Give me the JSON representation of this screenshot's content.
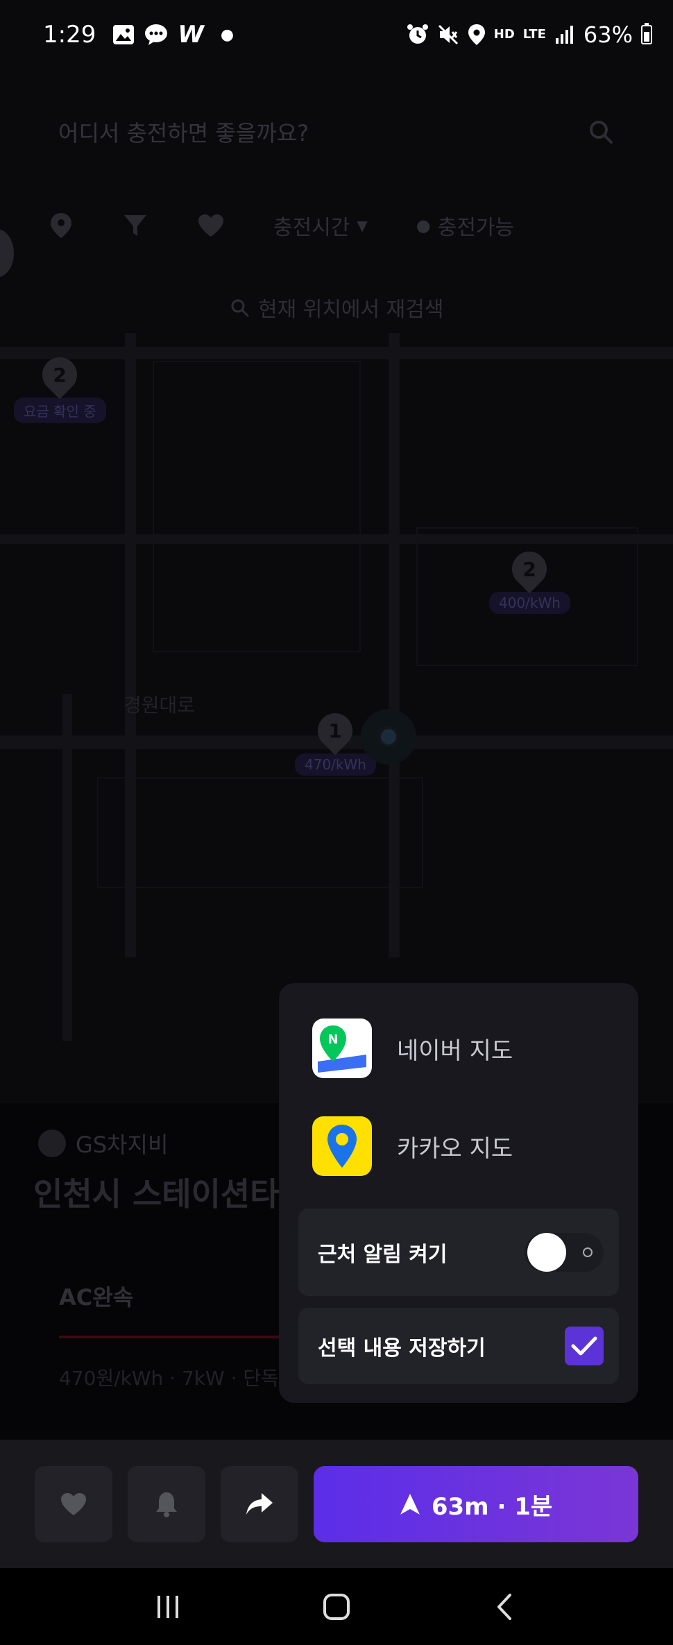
{
  "status_bar": {
    "time": "1:29",
    "net_hd": "HD",
    "net_lte": "LTE",
    "battery": "63%"
  },
  "map": {
    "search_placeholder": "어디서 충전하면 좋을까요?",
    "filters": {
      "charge_time": "충전시간",
      "charge_available": "충전가능"
    },
    "research_label": "현재 위치에서 재검색",
    "pins": [
      {
        "count": "2",
        "label": "요금 확인 중"
      },
      {
        "count": "2",
        "label": "400/kWh"
      },
      {
        "count": "1",
        "label": "470/kWh"
      }
    ],
    "place_name": "경원대로"
  },
  "station": {
    "brand": "GS차지비",
    "name": "인천시 스테이션타",
    "tab": "AC완속",
    "info": "470원/kWh · 7kW · 단독"
  },
  "actions": {
    "navigate_label": "63m · 1분"
  },
  "popup": {
    "options": [
      {
        "label": "네이버 지도",
        "icon": "naver-map-icon"
      },
      {
        "label": "카카오 지도",
        "icon": "kakao-map-icon"
      }
    ],
    "nearby_alert": {
      "label": "근처 알림 켜기",
      "enabled": false
    },
    "save_selection": {
      "label": "선택 내용 저장하기",
      "checked": true
    }
  },
  "colors": {
    "accent": "#5b2ee8",
    "popup_bg": "#18181e",
    "kakao_yellow": "#ffe000",
    "naver_green": "#03c75a"
  }
}
